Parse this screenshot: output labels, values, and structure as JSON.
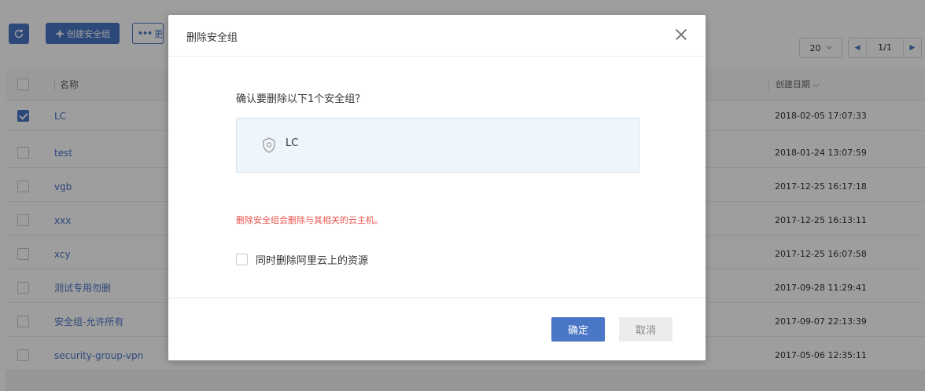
{
  "toolbar": {
    "refresh_icon": "refresh-icon",
    "create_label": "创建安全组",
    "create_icon": "plus-icon",
    "more_label": "更",
    "more_icon": "ellipsis-icon"
  },
  "pagination": {
    "page_size": "20",
    "page_indicator": "1/1"
  },
  "table": {
    "headers": {
      "name": "名称",
      "date": "创建日期"
    },
    "rows": [
      {
        "name": "LC",
        "date": "2018-02-05 17:07:33",
        "checked": true
      },
      {
        "name": "test",
        "date": "2018-01-24 13:07:59",
        "checked": false
      },
      {
        "name": "vgb",
        "date": "2017-12-25 16:17:18",
        "checked": false
      },
      {
        "name": "xxx",
        "date": "2017-12-25 16:13:11",
        "checked": false
      },
      {
        "name": "xcy",
        "date": "2017-12-25 16:07:58",
        "checked": false
      },
      {
        "name": "测试专用勿删",
        "date": "2017-09-28 11:29:41",
        "checked": false
      },
      {
        "name": "安全组-允许所有",
        "date": "2017-09-07 22:13:39",
        "checked": false
      },
      {
        "name": "security-group-vpn",
        "date": "2017-05-06 12:35:11",
        "checked": false
      }
    ]
  },
  "modal": {
    "title": "删除安全组",
    "confirm_question": "确认要删除以下1个安全组？",
    "items": [
      {
        "name": "LC",
        "icon": "shield-icon"
      }
    ],
    "warning": "删除安全组会删除与其相关的云主机。",
    "also_delete_label": "同时删除阿里云上的资源",
    "ok_label": "确定",
    "cancel_label": "取消"
  },
  "colors": {
    "primary": "#4a76c6",
    "warning": "#e8554e"
  }
}
